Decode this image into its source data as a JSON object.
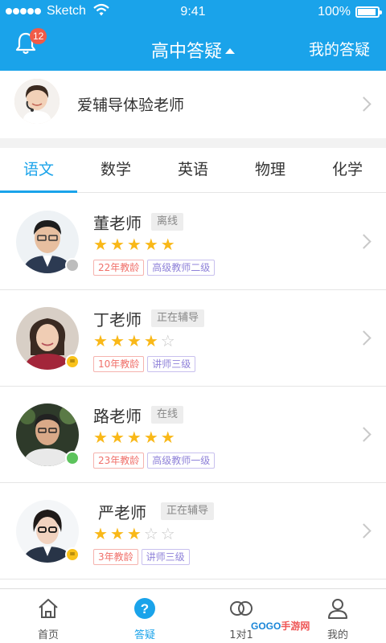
{
  "status_bar": {
    "carrier": "Sketch",
    "time": "9:41",
    "battery": "100%"
  },
  "nav": {
    "notification_count": "12",
    "title": "高中答疑",
    "right_link": "我的答疑"
  },
  "tutor": {
    "name": "爱辅导体验老师"
  },
  "subjects": [
    {
      "label": "语文",
      "active": true
    },
    {
      "label": "数学",
      "active": false
    },
    {
      "label": "英语",
      "active": false
    },
    {
      "label": "物理",
      "active": false
    },
    {
      "label": "化学",
      "active": false
    }
  ],
  "teachers": [
    {
      "name": "董老师",
      "status": "离线",
      "rating": 5,
      "experience": "22年教龄",
      "title": "高级教师二级",
      "dot": "gray"
    },
    {
      "name": "丁老师",
      "status": "正在辅导",
      "rating": 4,
      "experience": "10年教龄",
      "title": "讲师三级",
      "dot": "yellow"
    },
    {
      "name": "路老师",
      "status": "在线",
      "rating": 5,
      "experience": "23年教龄",
      "title": "高级教师一级",
      "dot": "green"
    },
    {
      "name": "严老师",
      "status": "正在辅导",
      "rating": 3,
      "experience": "3年教龄",
      "title": "讲师三级",
      "dot": "yellow"
    }
  ],
  "tabbar": [
    {
      "label": "首页",
      "icon": "home-icon",
      "active": false
    },
    {
      "label": "答疑",
      "icon": "question-icon",
      "active": true
    },
    {
      "label": "1对1",
      "icon": "one-on-one-icon",
      "active": false
    },
    {
      "label": "我的",
      "icon": "profile-icon",
      "active": false
    }
  ],
  "watermark": {
    "brand": "GOGO",
    "sub": "手游网"
  },
  "colors": {
    "brand": "#1aa3ea",
    "star": "#f9b818",
    "badge": "#f05b48",
    "dot_gray": "#bdbdbd",
    "dot_yellow": "#f9c21a",
    "dot_green": "#5cc35c"
  }
}
